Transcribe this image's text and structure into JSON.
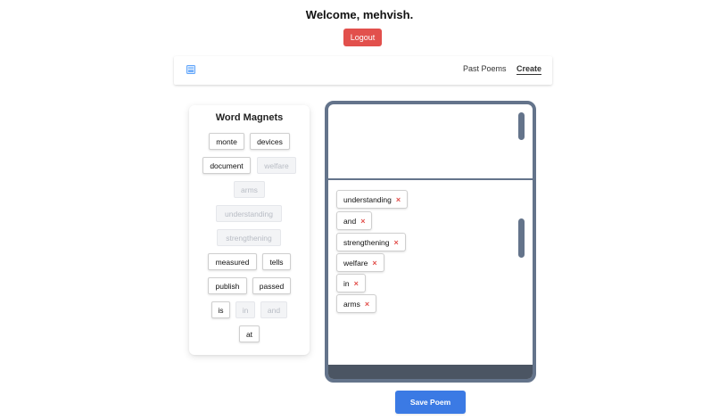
{
  "header": {
    "welcome": "Welcome, mehvish.",
    "logout_label": "Logout"
  },
  "nav": {
    "logo_icon": "fridge-logo-icon",
    "links": [
      {
        "label": "Past Poems",
        "active": false
      },
      {
        "label": "Create",
        "active": true
      }
    ]
  },
  "magnets": {
    "title": "Word Magnets",
    "words": [
      {
        "text": "monte",
        "used": false
      },
      {
        "text": "devices",
        "used": false
      },
      {
        "text": "document",
        "used": false
      },
      {
        "text": "welfare",
        "used": true
      },
      {
        "text": "arms",
        "used": true
      },
      {
        "text": "understanding",
        "used": true
      },
      {
        "text": "strengthening",
        "used": true
      },
      {
        "text": "measured",
        "used": false
      },
      {
        "text": "tells",
        "used": false
      },
      {
        "text": "publish",
        "used": false
      },
      {
        "text": "passed",
        "used": false
      },
      {
        "text": "is",
        "used": false
      },
      {
        "text": "in",
        "used": true
      },
      {
        "text": "and",
        "used": true
      },
      {
        "text": "at",
        "used": false
      }
    ]
  },
  "poem": {
    "words": [
      "understanding",
      "and",
      "strengthening",
      "welfare",
      "in",
      "arms"
    ],
    "remove_symbol": "×"
  },
  "save_label": "Save Poem",
  "colors": {
    "danger": "#e2504c",
    "primary": "#3b7ae4",
    "fridge": "#64748b"
  }
}
